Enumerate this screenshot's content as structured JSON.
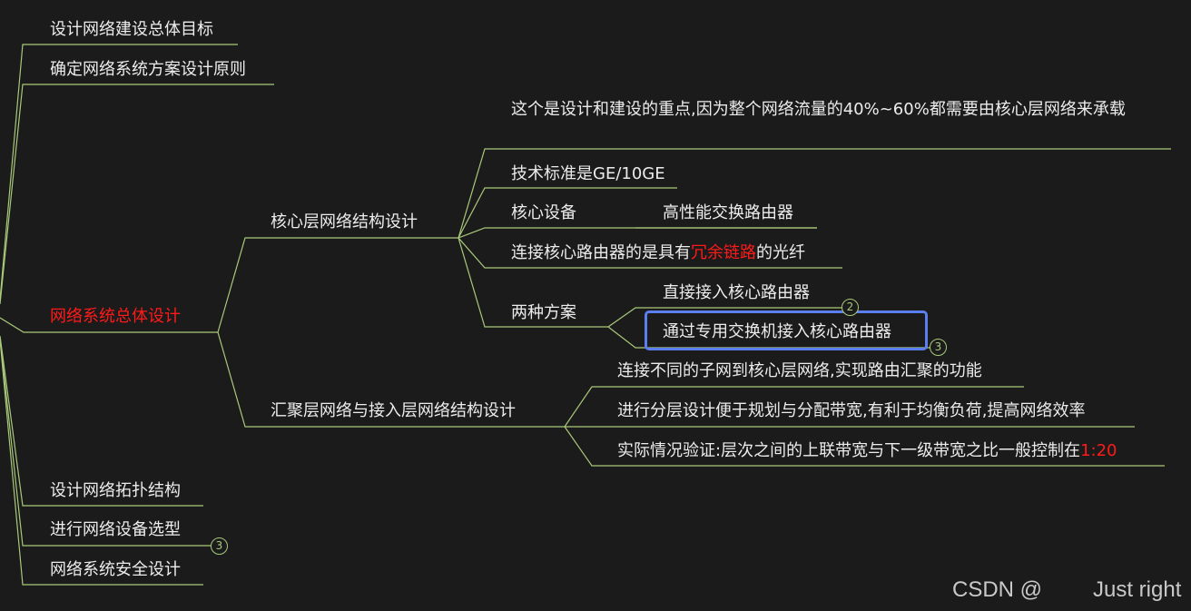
{
  "mindmap": {
    "left_branches_top": [
      {
        "label": "设计网络建设总体目标"
      },
      {
        "label": "确定网络系统方案设计原则"
      }
    ],
    "main_topic": {
      "label": "网络系统总体设计",
      "color": "#ff1a1a"
    },
    "core_layer": {
      "label": "核心层网络结构设计",
      "children": {
        "focus": "这个是设计和建设的重点,因为整个网络流量的40%~60%都需要由核心层网络来承载",
        "standard": "技术标准是GE/10GE",
        "device_label": "核心设备",
        "device_value": "高性能交换路由器",
        "link_prefix": "连接核心路由器的是具有",
        "link_highlight": "冗余链路",
        "link_suffix": "的光纤",
        "schemes_label": "两种方案",
        "scheme_1": "直接接入核心路由器",
        "scheme_2": "通过专用交换机接入核心路由器",
        "scheme_1_badge": "2",
        "scheme_2_badge": "3"
      }
    },
    "aggregation_layer": {
      "label": "汇聚层网络与接入层网络结构设计",
      "children": {
        "item_1": "连接不同的子网到核心层网络,实现路由汇聚的功能",
        "item_2": "进行分层设计便于规划与分配带宽,有利于均衡负荷,提高网络效率",
        "item_3_prefix": "实际情况验证:层次之间的上联带宽与下一级带宽之比一般控制在",
        "item_3_highlight": "1:20"
      }
    },
    "left_branches_bottom": [
      {
        "label": "设计网络拓扑结构"
      },
      {
        "label": "进行网络设备选型",
        "badge": "3"
      },
      {
        "label": "网络系统安全设计"
      }
    ]
  },
  "colors": {
    "background": "#1b1b1b",
    "line": "#a9c97a",
    "text": "#ececec",
    "highlight": "#ff1a1a",
    "selection": "#5b7ff0"
  },
  "watermark": {
    "left": "CSDN @",
    "right": "Just right"
  }
}
